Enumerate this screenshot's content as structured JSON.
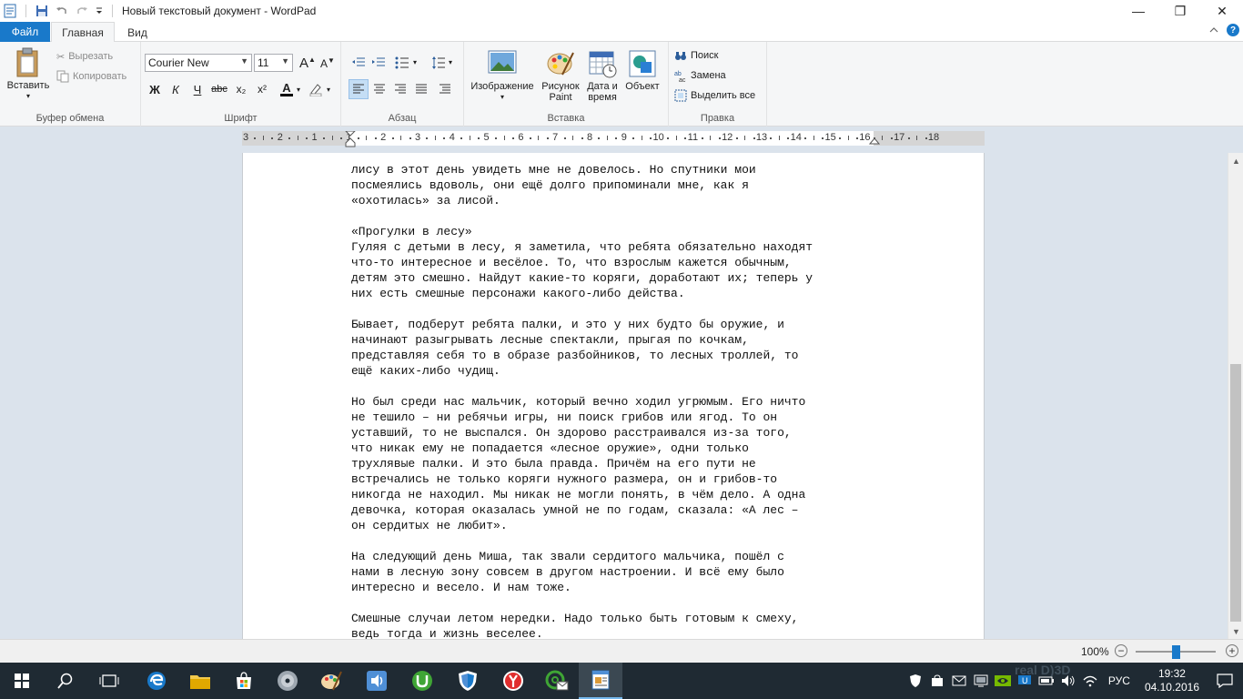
{
  "window": {
    "title": "Новый текстовый документ - WordPad",
    "minimize": "—",
    "maximize": "❐",
    "close": "✕"
  },
  "tabs": {
    "file": "Файл",
    "home": "Главная",
    "view": "Вид"
  },
  "ribbon": {
    "clipboard": {
      "label": "Буфер обмена",
      "paste": "Вставить",
      "cut": "Вырезать",
      "copy": "Копировать"
    },
    "font": {
      "label": "Шрифт",
      "family": "Courier New",
      "size": "11",
      "bold": "Ж",
      "italic": "К",
      "underline": "Ч",
      "strike": "abc",
      "subscript": "x₂",
      "superscript": "x²",
      "color_letter": "A"
    },
    "paragraph": {
      "label": "Абзац"
    },
    "insert": {
      "label": "Вставка",
      "image": "Изображение",
      "paint_line1": "Рисунок",
      "paint_line2": "Paint",
      "datetime_line1": "Дата и",
      "datetime_line2": "время",
      "object": "Объект"
    },
    "editing": {
      "label": "Правка",
      "find": "Поиск",
      "replace": "Замена",
      "select_all": "Выделить все"
    }
  },
  "ruler": {
    "labels": [
      "3",
      "2",
      "1",
      "1",
      "2",
      "3",
      "4",
      "5",
      "6",
      "7",
      "8",
      "9",
      "10",
      "11",
      "12",
      "13",
      "14",
      "15",
      "16",
      "17",
      "18"
    ]
  },
  "document": {
    "text": "лису в этот день увидеть мне не довелось. Но спутники мои\nпосмеялись вдоволь, они ещё долго припоминали мне, как я\n«охотилась» за лисой.\n\n«Прогулки в лесу»\nГуляя с детьми в лесу, я заметила, что ребята обязательно находят\nчто-то интересное и весёлое. То, что взрослым кажется обычным,\nдетям это смешно. Найдут какие-то коряги, доработают их; теперь у\nних есть смешные персонажи какого-либо действа.\n\nБывает, подберут ребята палки, и это у них будто бы оружие, и\nначинают разыгрывать лесные спектакли, прыгая по кочкам,\nпредставляя себя то в образе разбойников, то лесных троллей, то\nещё каких-либо чудищ.\n\nНо был среди нас мальчик, который вечно ходил угрюмым. Его ничто\nне тешило – ни ребячьи игры, ни поиск грибов или ягод. То он\nуставший, то не выспался. Он здорово расстраивался из-за того,\nчто никак ему не попадается «лесное оружие», одни только\nтрухлявые палки. И это была правда. Причём на его пути не\nвстречались не только коряги нужного размера, он и грибов-то\nникогда не находил. Мы никак не могли понять, в чём дело. А одна\nдевочка, которая оказалась умной не по годам, сказала: «А лес –\nон сердитых не любит».\n\nНа следующий день Миша, так звали сердитого мальчика, пошёл с\nнами в лесную зону совсем в другом настроении. И всё ему было\nинтересно и весело. И нам тоже.\n\nСмешные случаи летом нередки. Надо только быть готовым к смеху,\nведь тогда и жизнь веселее."
  },
  "statusbar": {
    "zoom": "100%",
    "zoom_minus": "−",
    "zoom_plus": "+",
    "zoom_level": 0.5
  },
  "taskbar": {
    "language": "РУС",
    "time": "19:32",
    "date": "04.10.2016",
    "watermark": "real D)3D"
  }
}
